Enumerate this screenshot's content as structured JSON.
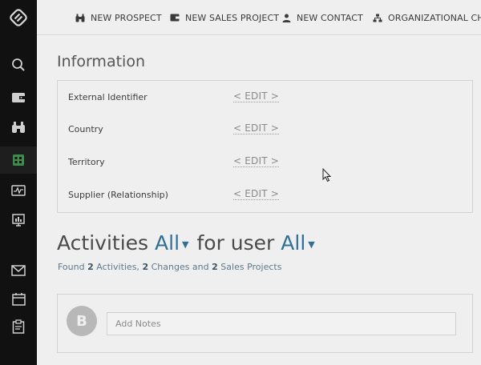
{
  "topbar": {
    "items": [
      {
        "label": "NEW PROSPECT",
        "icon": "binoculars-icon"
      },
      {
        "label": "NEW SALES PROJECT",
        "icon": "wallet-icon"
      },
      {
        "label": "NEW CONTACT",
        "icon": "person-icon"
      },
      {
        "label": "ORGANIZATIONAL CHAR",
        "icon": "org-chart-icon"
      }
    ]
  },
  "sidebar": {
    "items": [
      {
        "icon": "logo-icon"
      },
      {
        "icon": "search-icon"
      },
      {
        "icon": "wallet-icon"
      },
      {
        "icon": "binoculars-icon"
      },
      {
        "icon": "accounts-icon",
        "active": true
      },
      {
        "icon": "activity-icon"
      },
      {
        "icon": "reports-icon"
      },
      {
        "icon": "mail-icon"
      },
      {
        "icon": "calendar-icon"
      },
      {
        "icon": "clipboard-icon"
      }
    ],
    "active_color": "#3d8c4a"
  },
  "information": {
    "title": "Information",
    "rows": [
      {
        "label": "External Identifier",
        "value": "< EDIT >"
      },
      {
        "label": "Country",
        "value": "< EDIT >"
      },
      {
        "label": "Territory",
        "value": "< EDIT >"
      },
      {
        "label": "Supplier (Relationship)",
        "value": "< EDIT >"
      }
    ]
  },
  "activities": {
    "prefix": "Activities",
    "filter_value": "All",
    "middle": "for user",
    "user_value": "All",
    "found": {
      "prefix": "Found",
      "activities_count": "2",
      "activities_label": "Activities,",
      "changes_count": "2",
      "changes_label": "Changes and",
      "projects_count": "2",
      "projects_label": "Sales Projects"
    }
  },
  "notes": {
    "avatar_letter": "B",
    "placeholder": "Add Notes"
  }
}
